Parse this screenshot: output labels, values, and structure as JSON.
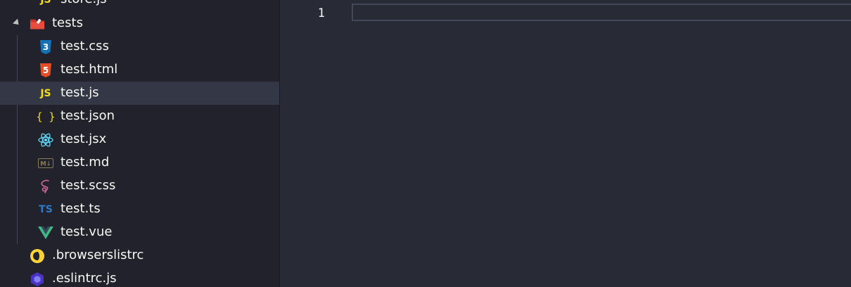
{
  "explorer": {
    "items": [
      {
        "label": "store.js",
        "icon": "js-icon"
      },
      {
        "label": "tests",
        "icon": "tests-folder-icon",
        "expanded": true
      },
      {
        "label": "test.css",
        "icon": "css3-icon"
      },
      {
        "label": "test.html",
        "icon": "html5-icon"
      },
      {
        "label": "test.js",
        "icon": "js-icon",
        "selected": true
      },
      {
        "label": "test.json",
        "icon": "json-braces-icon"
      },
      {
        "label": "test.jsx",
        "icon": "react-icon"
      },
      {
        "label": "test.md",
        "icon": "markdown-icon"
      },
      {
        "label": "test.scss",
        "icon": "sass-icon"
      },
      {
        "label": "test.ts",
        "icon": "typescript-icon"
      },
      {
        "label": "test.vue",
        "icon": "vue-icon"
      },
      {
        "label": ".browserslistrc",
        "icon": "browserslist-icon"
      },
      {
        "label": ".eslintrc.js",
        "icon": "eslint-icon"
      }
    ],
    "icon_text": {
      "js": "JS",
      "ts": "TS",
      "json": "{ }",
      "css": "3",
      "html": "5",
      "md": "M↓"
    }
  },
  "editor": {
    "line_numbers": [
      "1"
    ],
    "content": ""
  },
  "colors": {
    "sidebar_bg": "#21222c",
    "editor_bg": "#282a36",
    "selection_bg": "#343746",
    "text": "#f8f8f2",
    "js_yellow": "#f5de19",
    "ts_blue": "#3178c6",
    "css_blue": "#1572b6",
    "html_orange": "#e44d26",
    "react_cyan": "#61dafb",
    "vue_green": "#41b883",
    "sass_pink": "#cd6799"
  }
}
